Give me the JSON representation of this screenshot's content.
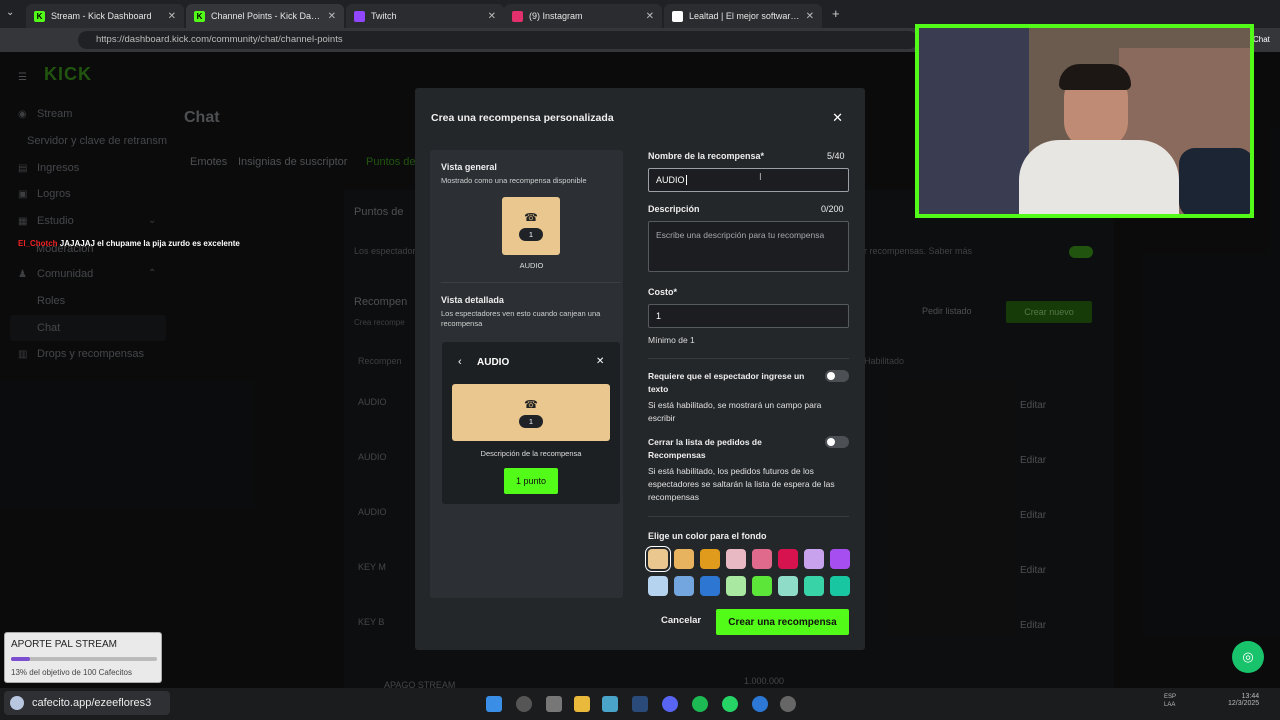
{
  "browser": {
    "tabs": [
      {
        "title": "Stream - Kick Dashboard",
        "icon": "kick-icon",
        "color": "#53fc18"
      },
      {
        "title": "Channel Points - Kick Dashboard",
        "icon": "kick-icon",
        "color": "#53fc18"
      },
      {
        "title": "Twitch",
        "icon": "twitch-icon",
        "color": "#9146ff"
      },
      {
        "title": "(9) Instagram",
        "icon": "instagram-icon",
        "color": "#e1306c"
      },
      {
        "title": "Lealtad | El mejor software para p...",
        "icon": "generic-icon",
        "color": "#ffffff"
      }
    ],
    "url": "https://dashboard.kick.com/community/chat/channel-points",
    "chat_label": "Chat"
  },
  "sidebar": {
    "logo": "KICK",
    "items": [
      {
        "label": "Stream",
        "icon": "broadcast-icon"
      },
      {
        "label": "Servidor y clave de retransm",
        "icon": ""
      },
      {
        "label": "Ingresos",
        "icon": "dollar-icon"
      },
      {
        "label": "Logros",
        "icon": "trophy-icon"
      },
      {
        "label": "Estudio",
        "icon": "grid-icon"
      },
      {
        "label": "Moderación",
        "icon": "shield-icon"
      },
      {
        "label": "Comunidad",
        "icon": "users-icon"
      },
      {
        "label": "Roles",
        "icon": ""
      },
      {
        "label": "Chat",
        "icon": ""
      },
      {
        "label": "Drops y recompensas",
        "icon": "gift-icon"
      }
    ]
  },
  "chat_overlay_message": {
    "user": "El_Chotch",
    "text": "JAJAJAJ el chupame la pija zurdo es excelente"
  },
  "main": {
    "title": "Chat",
    "tabs": [
      "Emotes",
      "Insignias de suscriptor",
      "Puntos de"
    ],
    "section_points": "Puntos de",
    "points_desc": "Los espectador",
    "points_desc_right": "r recompensas. Saber más",
    "rewards_title": "Recompen",
    "rewards_sub": "Crea recompe",
    "col_reward": "Recompen",
    "col_enabled": "Habilitado",
    "request_list": "Pedir listado",
    "create_new": "Crear nuevo",
    "edit_label": "Editar",
    "rows": [
      "AUDIO",
      "AUDIO",
      "AUDIO",
      "KEY M",
      "KEY B",
      "APAGO STREAM"
    ],
    "row_cost_partial": "1.000.000"
  },
  "modal": {
    "title": "Crea una recompensa personalizada",
    "overview_title": "Vista general",
    "overview_sub": "Mostrado como una recompensa disponible",
    "card_count": "1",
    "card_name": "AUDIO",
    "detail_title": "Vista detallada",
    "detail_sub": "Los espectadores ven esto cuando canjean una recompensa",
    "detail_name": "AUDIO",
    "detail_desc": "Descripción de la recompensa",
    "detail_button": "1 punto",
    "name_label": "Nombre de la recompensa*",
    "name_counter": "5/40",
    "name_value": "AUDIO",
    "desc_label": "Descripción",
    "desc_counter": "0/200",
    "desc_placeholder": "Escribe una descripción para tu recompensa",
    "cost_label": "Costo*",
    "cost_value": "1",
    "cost_min": "Mínimo de 1",
    "require_text_label": "Requiere que el espectador ingrese un texto",
    "require_text_help": "Si está habilitado, se mostrará un campo para escribir",
    "close_list_label": "Cerrar la lista de pedidos de Recompensas",
    "close_list_help": "Si está habilitado, los pedidos futuros de los espectadores se saltarán la lista de espera de las recompensas",
    "color_label": "Elige un color para el fondo",
    "colors": [
      "#e9c78f",
      "#e8b35e",
      "#e09a1c",
      "#e8b9c3",
      "#e06a8c",
      "#d6124f",
      "#c8a2ec",
      "#a64ef0",
      "#b5d3ef",
      "#73a5de",
      "#2d76d2",
      "#a8e8a0",
      "#5ce63a",
      "#8fdcc8",
      "#38d4a7",
      "#18c6a1"
    ],
    "cancel": "Cancelar",
    "create": "Crear una recompensa"
  },
  "donation": {
    "title": "APORTE PAL STREAM",
    "progress": 0.13,
    "text": "13% del objetivo de 100 Cafecitos"
  },
  "cafecito_url": "cafecito.app/ezeeflores3",
  "taskbar": {
    "lang": "ESP\nLAA",
    "time": "13:44",
    "date": "12/3/2025"
  }
}
